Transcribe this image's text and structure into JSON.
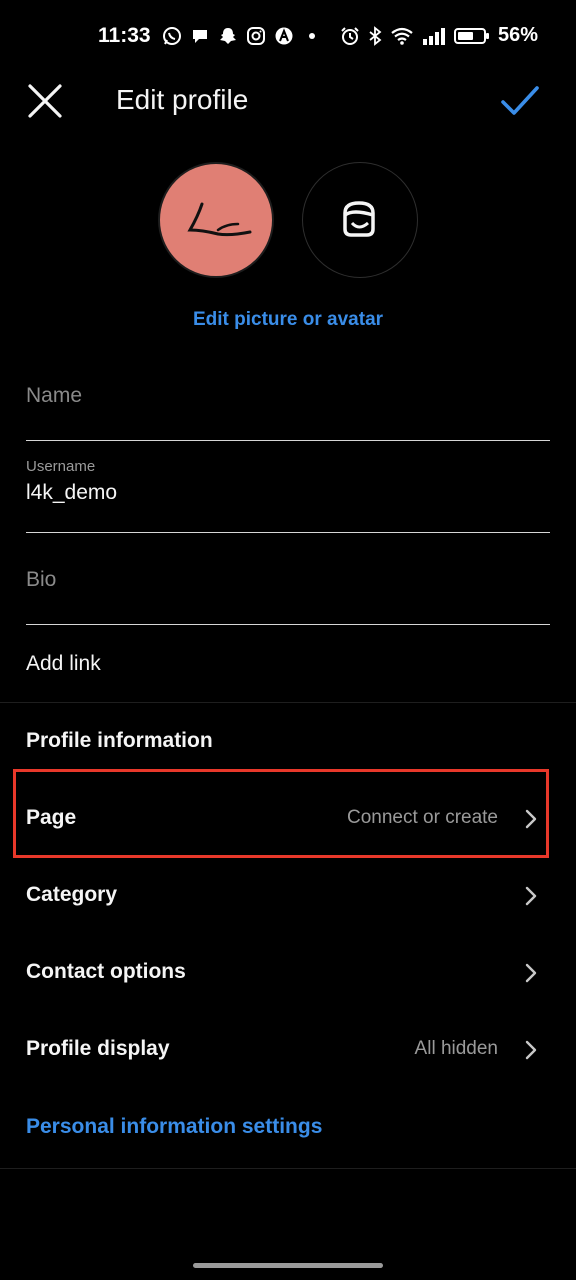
{
  "status_bar": {
    "time": "11:33",
    "battery": "56%",
    "left_icons": [
      "whatsapp-icon",
      "chat-icon",
      "snapchat-icon",
      "instagram-icon",
      "app-icon",
      "dot-icon"
    ],
    "right_icons": [
      "alarm-icon",
      "bluetooth-icon",
      "wifi-icon",
      "signal-icon",
      "battery-icon"
    ]
  },
  "header": {
    "title": "Edit profile"
  },
  "avatar": {
    "edit_label": "Edit picture or avatar",
    "photo_color": "#e07f74"
  },
  "form": {
    "name_placeholder": "Name",
    "username_label": "Username",
    "username_value": "l4k_demo",
    "bio_placeholder": "Bio",
    "add_link": "Add link"
  },
  "profile_info": {
    "title": "Profile information",
    "rows": [
      {
        "label": "Page",
        "value": "Connect or create"
      },
      {
        "label": "Category",
        "value": ""
      },
      {
        "label": "Contact options",
        "value": ""
      },
      {
        "label": "Profile display",
        "value": "All hidden"
      }
    ]
  },
  "personal_info_link": "Personal information settings",
  "colors": {
    "background": "#000000",
    "accent_blue": "#3a8de8",
    "highlight_red": "#e8382a"
  }
}
